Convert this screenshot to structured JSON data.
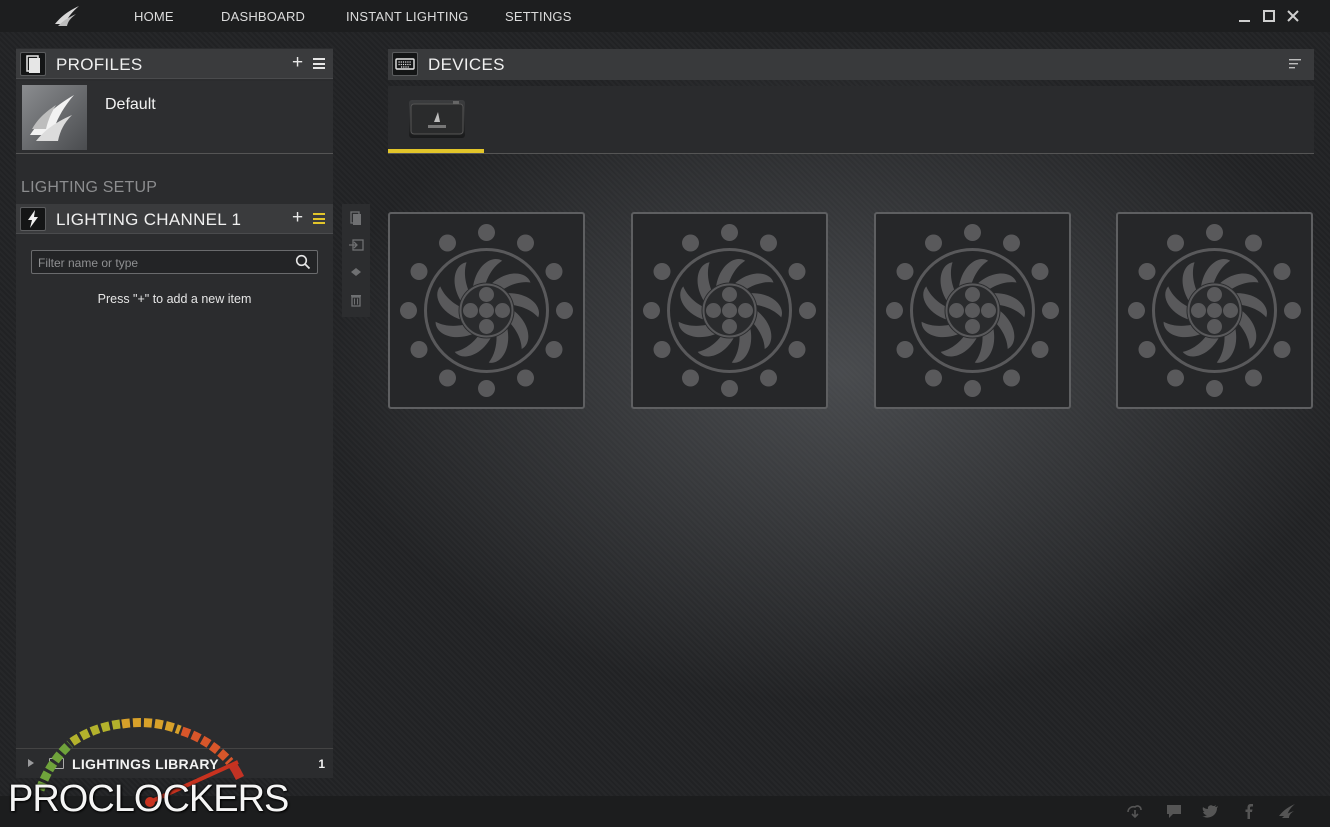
{
  "topbar": {
    "nav": [
      "HOME",
      "DASHBOARD",
      "INSTANT LIGHTING",
      "SETTINGS"
    ]
  },
  "profiles": {
    "title": "PROFILES",
    "items": [
      {
        "name": "Default"
      }
    ]
  },
  "lighting_setup": {
    "label": "LIGHTING SETUP",
    "channel_title": "LIGHTING CHANNEL 1",
    "search_placeholder": "Filter name or type",
    "hint": "Press \"+\" to add a new item"
  },
  "library": {
    "title": "LIGHTINGS LIBRARY",
    "count": "1"
  },
  "devices": {
    "title": "DEVICES",
    "fan_count": 4
  },
  "watermark": {
    "text": "PROCLOCKERS"
  },
  "colors": {
    "accent": "#e2c52a",
    "panel": "#2b2c2e",
    "header": "#3a3b3d"
  },
  "icons": {
    "window": [
      "minimize-icon",
      "maximize-icon",
      "close-icon"
    ],
    "tools": [
      "copy-icon",
      "paste-icon",
      "move-icon",
      "trash-icon"
    ],
    "status": [
      "download-icon",
      "chat-icon",
      "twitter-icon",
      "facebook-icon",
      "corsair-icon"
    ]
  }
}
